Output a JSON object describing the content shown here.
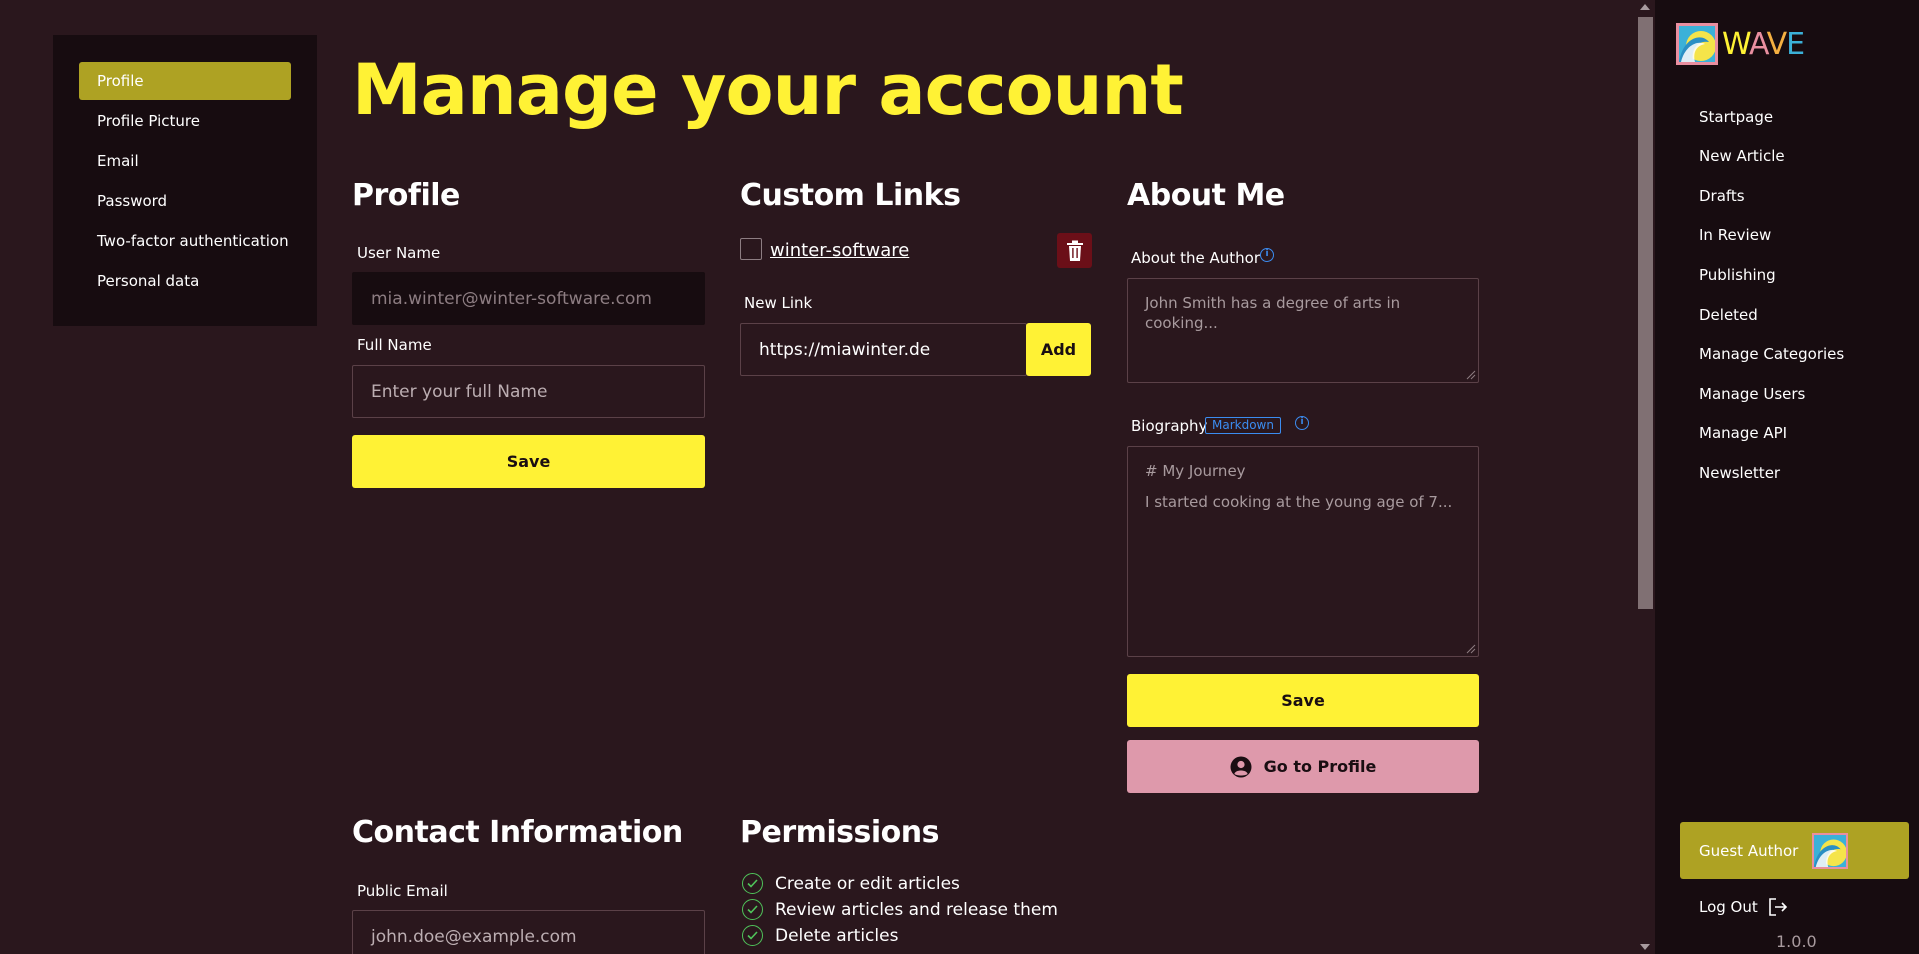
{
  "settings_nav": {
    "items": [
      {
        "label": "Profile",
        "active": true
      },
      {
        "label": "Profile Picture"
      },
      {
        "label": "Email"
      },
      {
        "label": "Password"
      },
      {
        "label": "Two-factor authentication"
      },
      {
        "label": "Personal data"
      }
    ]
  },
  "page_title": "Manage your account",
  "profile": {
    "title": "Profile",
    "username_label": "User Name",
    "username_value": "mia.winter@winter-software.com",
    "fullname_label": "Full Name",
    "fullname_placeholder": "Enter your full Name",
    "save_label": "Save"
  },
  "custom_links": {
    "title": "Custom Links",
    "links": [
      {
        "label": "winter-software"
      }
    ],
    "new_link_label": "New Link",
    "new_link_value": "https://miawinter.de",
    "add_label": "Add"
  },
  "about_me": {
    "title": "About Me",
    "author_label": "About the Author",
    "author_placeholder": "John Smith has a degree of arts in cooking...",
    "biography_label": "Biography",
    "markdown_badge": "Markdown",
    "biography_placeholder_line1": "# My Journey",
    "biography_placeholder_line2": "I started cooking at the young age of 7...",
    "save_label": "Save",
    "go_to_profile_label": "Go to Profile"
  },
  "contact": {
    "title": "Contact Information",
    "public_email_label": "Public Email",
    "public_email_placeholder": "john.doe@example.com"
  },
  "permissions": {
    "title": "Permissions",
    "items": [
      {
        "label": "Create or edit articles"
      },
      {
        "label": "Review articles and release them"
      },
      {
        "label": "Delete articles"
      }
    ]
  },
  "app_sidebar": {
    "logo_text": "WAVE",
    "links": [
      {
        "label": "Startpage"
      },
      {
        "label": "New Article"
      },
      {
        "label": "Drafts"
      },
      {
        "label": "In Review"
      },
      {
        "label": "Publishing"
      },
      {
        "label": "Deleted"
      },
      {
        "label": "Manage Categories"
      },
      {
        "label": "Manage Users"
      },
      {
        "label": "Manage API"
      },
      {
        "label": "Newsletter"
      }
    ],
    "user_role": "Guest Author",
    "logout_label": "Log Out",
    "version": "1.0.0"
  },
  "colors": {
    "background": "#2a171d",
    "panel": "#170c10",
    "accent_yellow": "#fff235",
    "active_olive": "#aea223",
    "pink_button": "#de99ab",
    "danger": "#6b0f18",
    "info_blue": "#3b8cf0",
    "check_green": "#4fc35a"
  },
  "icons": [
    "trash-icon",
    "info-icon",
    "user-circle-icon",
    "logout-icon",
    "check-circle-icon",
    "wave-logo"
  ]
}
